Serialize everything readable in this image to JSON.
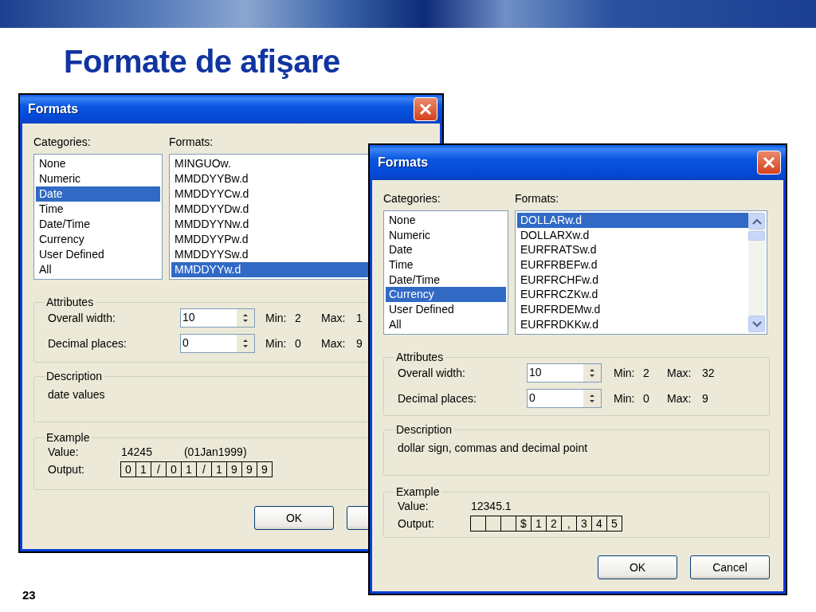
{
  "slide": {
    "title": "Formate de afişare",
    "page_number": "23"
  },
  "dialogs": [
    {
      "title": "Formats",
      "categories_label": "Categories:",
      "formats_label": "Formats:",
      "categories": [
        {
          "label": "None",
          "selected": false
        },
        {
          "label": "Numeric",
          "selected": false
        },
        {
          "label": "Date",
          "selected": true
        },
        {
          "label": "Time",
          "selected": false
        },
        {
          "label": "Date/Time",
          "selected": false
        },
        {
          "label": "Currency",
          "selected": false
        },
        {
          "label": "User Defined",
          "selected": false
        },
        {
          "label": "All",
          "selected": false
        }
      ],
      "formats": [
        {
          "label": "MINGUOw.",
          "selected": false
        },
        {
          "label": "MMDDYYBw.d",
          "selected": false
        },
        {
          "label": "MMDDYYCw.d",
          "selected": false
        },
        {
          "label": "MMDDYYDw.d",
          "selected": false
        },
        {
          "label": "MMDDYYNw.d",
          "selected": false
        },
        {
          "label": "MMDDYYPw.d",
          "selected": false
        },
        {
          "label": "MMDDYYSw.d",
          "selected": false
        },
        {
          "label": "MMDDYYw.d",
          "selected": true
        }
      ],
      "attributes": {
        "legend": "Attributes",
        "rows": [
          {
            "label": "Overall width:",
            "value": "10",
            "min_label": "Min:",
            "min": "2",
            "max_label": "Max:",
            "max": "1"
          },
          {
            "label": "Decimal places:",
            "value": "0",
            "min_label": "Min:",
            "min": "0",
            "max_label": "Max:",
            "max": "9"
          }
        ]
      },
      "description": {
        "legend": "Description",
        "text": "date values"
      },
      "example": {
        "legend": "Example",
        "value_label": "Value:",
        "value": "14245",
        "value_note": "(01Jan1999)",
        "output_label": "Output:",
        "output": [
          {
            "text": "0"
          },
          {
            "text": "1"
          },
          {
            "text": "/"
          },
          {
            "text": "0"
          },
          {
            "text": "1"
          },
          {
            "text": "/"
          },
          {
            "text": "1"
          },
          {
            "text": "9"
          },
          {
            "text": "9"
          },
          {
            "text": "9"
          }
        ]
      },
      "buttons": [
        {
          "label": "OK"
        },
        {
          "covered": true
        }
      ]
    },
    {
      "title": "Formats",
      "categories_label": "Categories:",
      "formats_label": "Formats:",
      "scrollbar": true,
      "categories": [
        {
          "label": "None",
          "selected": false
        },
        {
          "label": "Numeric",
          "selected": false
        },
        {
          "label": "Date",
          "selected": false
        },
        {
          "label": "Time",
          "selected": false
        },
        {
          "label": "Date/Time",
          "selected": false
        },
        {
          "label": "Currency",
          "selected": true
        },
        {
          "label": "User Defined",
          "selected": false
        },
        {
          "label": "All",
          "selected": false
        }
      ],
      "formats": [
        {
          "label": "DOLLARw.d",
          "selected": true
        },
        {
          "label": "DOLLARXw.d",
          "selected": false
        },
        {
          "label": "EURFRATSw.d",
          "selected": false
        },
        {
          "label": "EURFRBEFw.d",
          "selected": false
        },
        {
          "label": "EURFRCHFw.d",
          "selected": false
        },
        {
          "label": "EURFRCZKw.d",
          "selected": false
        },
        {
          "label": "EURFRDEMw.d",
          "selected": false
        },
        {
          "label": "EURFRDKKw.d",
          "selected": false
        }
      ],
      "attributes": {
        "legend": "Attributes",
        "rows": [
          {
            "label": "Overall width:",
            "value": "10",
            "min_label": "Min:",
            "min": "2",
            "max_label": "Max:",
            "max": "32"
          },
          {
            "label": "Decimal places:",
            "value": "0",
            "min_label": "Min:",
            "min": "0",
            "max_label": "Max:",
            "max": "9"
          }
        ]
      },
      "description": {
        "legend": "Description",
        "text": "dollar sign, commas and decimal point"
      },
      "example": {
        "legend": "Example",
        "value_label": "Value:",
        "value": "12345.1",
        "output_label": "Output:",
        "output": [
          {
            "blank": true
          },
          {
            "blank": true
          },
          {
            "blank": true
          },
          {
            "text": "$"
          },
          {
            "text": "1"
          },
          {
            "text": "2"
          },
          {
            "text": ","
          },
          {
            "text": "3"
          },
          {
            "text": "4"
          },
          {
            "text": "5"
          }
        ]
      },
      "buttons": [
        {
          "label": "OK"
        },
        {
          "label": "Cancel"
        }
      ]
    }
  ]
}
